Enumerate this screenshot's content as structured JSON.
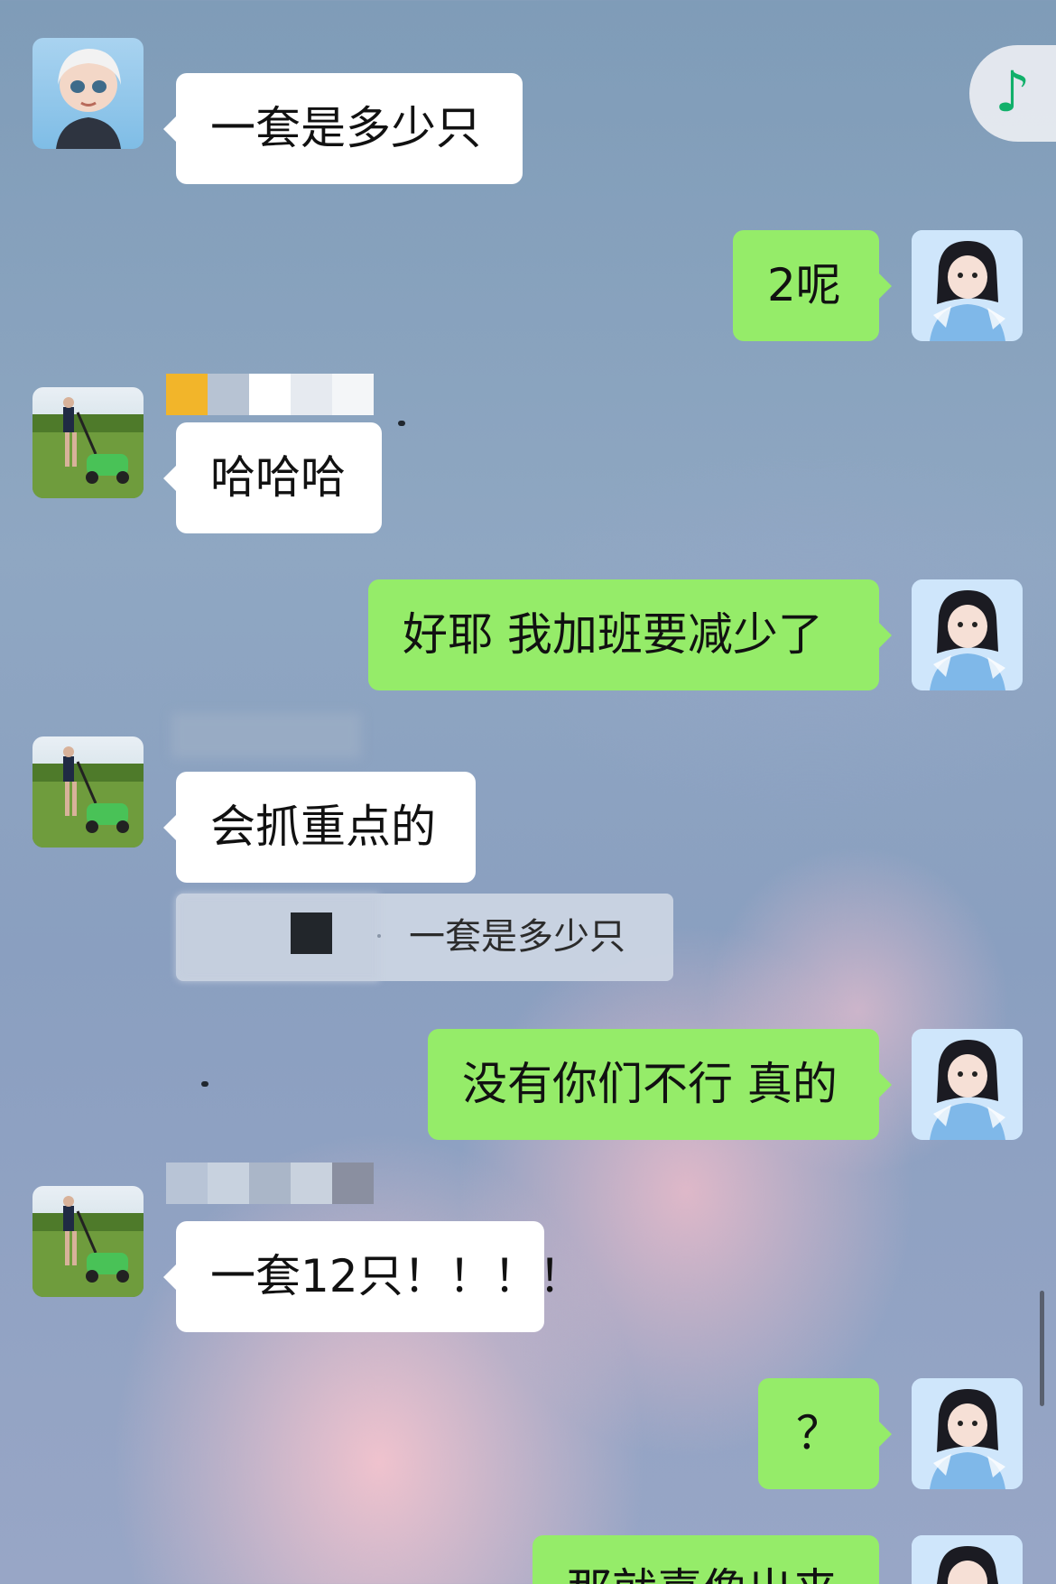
{
  "music": {
    "icon": "music-note-icon",
    "glyph": "♪"
  },
  "messages": [
    {
      "side": "left",
      "avatar": "robot-avatar",
      "text": "一套是多少只"
    },
    {
      "side": "right",
      "avatar": "girl-avatar",
      "text": "2呢"
    },
    {
      "side": "left",
      "avatar": "lawnmower-avatar",
      "text": "哈哈哈"
    },
    {
      "side": "right",
      "avatar": "girl-avatar",
      "text": "好耶  我加班要减少了"
    },
    {
      "side": "left",
      "avatar": "lawnmower-avatar",
      "text": "会抓重点的"
    },
    {
      "side": "right",
      "avatar": "girl-avatar",
      "text": "没有你们不行 真的"
    },
    {
      "side": "left",
      "avatar": "lawnmower-avatar",
      "text": "一套12只！！！！"
    },
    {
      "side": "right",
      "avatar": "girl-avatar",
      "text": "？"
    },
    {
      "side": "right",
      "avatar": "girl-avatar",
      "text": "那就喜像出来"
    }
  ],
  "quote": {
    "text": "一套是多少只"
  },
  "colors": {
    "incoming_bubble": "#ffffff",
    "outgoing_bubble": "#95ec69",
    "music_icon": "#11b06a"
  }
}
